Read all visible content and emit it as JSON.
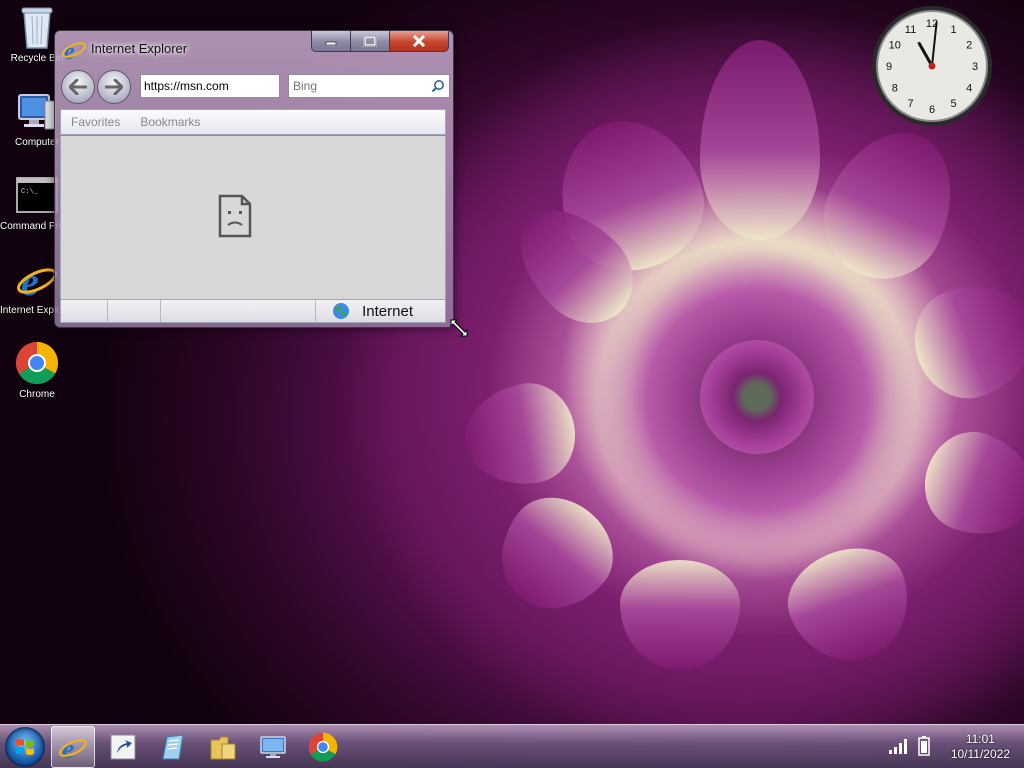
{
  "desktop": {
    "icons": [
      {
        "label": "Recycle Bin",
        "icon": "recycle-bin-icon"
      },
      {
        "label": "Computer",
        "icon": "computer-icon"
      },
      {
        "label": "Command Prompt",
        "icon": "command-prompt-icon"
      },
      {
        "label": "Internet Explorer",
        "icon": "internet-explorer-icon"
      },
      {
        "label": "Chrome",
        "icon": "chrome-icon"
      }
    ],
    "clock_gadget": {
      "hour": 11,
      "minute": 1,
      "numerals": [
        "12",
        "1",
        "2",
        "3",
        "4",
        "5",
        "6",
        "7",
        "8",
        "9",
        "10",
        "11"
      ]
    }
  },
  "window": {
    "title": "Internet Explorer",
    "address": "https://msn.com",
    "search_placeholder": "Bing",
    "favorites_bar": [
      "Favorites",
      "Bookmarks"
    ],
    "status_zone": "Internet"
  },
  "taskbar": {
    "items": [
      "internet-explorer-icon",
      "shortcut-icon",
      "document-icon",
      "folder-icon",
      "network-icon",
      "chrome-icon"
    ],
    "time": "11:01",
    "date": "10/11/2022"
  },
  "colors": {
    "ie_blue": "#1e73c8",
    "close_red": "#c6462f",
    "accent_purple": "#7b1e6e"
  }
}
